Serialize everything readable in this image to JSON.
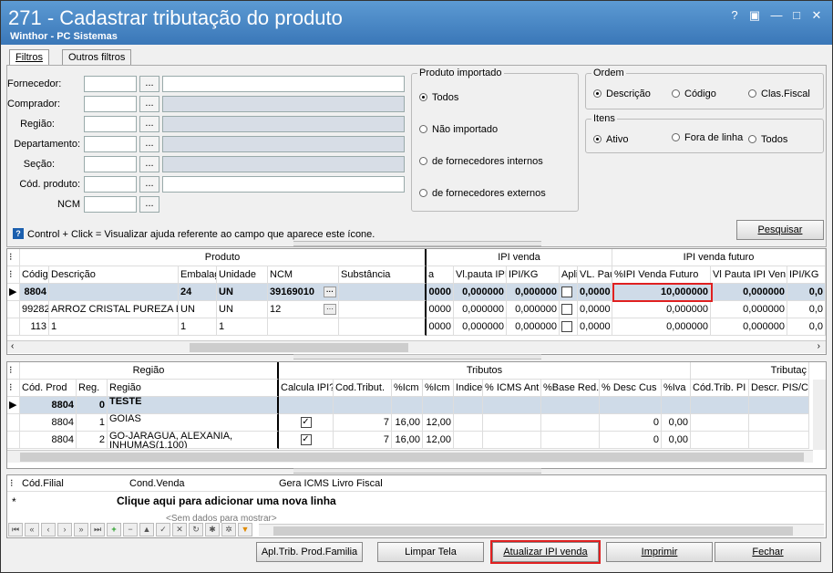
{
  "window": {
    "title": "271 - Cadastrar tributação do produto",
    "subtitle": "Winthor - PC Sistemas",
    "controls": {
      "help": "?",
      "restore": "▣",
      "minimize": "—",
      "maximize": "□",
      "close": "✕"
    }
  },
  "tabs": [
    "Filtros",
    "Outros filtros"
  ],
  "filters": {
    "fornecedor": "Fornecedor:",
    "comprador": "Comprador:",
    "regiao": "Região:",
    "departamento": "Departamento:",
    "secao": "Seção:",
    "cod_produto": "Cód. produto:",
    "ncm": "NCM",
    "dots": "..."
  },
  "produto_importado": {
    "title": "Produto importado",
    "options": [
      "Todos",
      "Não importado",
      "de fornecedores internos",
      "de fornecedores externos"
    ],
    "selected": 0
  },
  "ordem": {
    "title": "Ordem",
    "options": [
      "Descrição",
      "Código",
      "Clas.Fiscal"
    ],
    "selected": 0
  },
  "itens": {
    "title": "Itens",
    "options": [
      "Ativo",
      "Fora de linha",
      "Todos"
    ],
    "selected": 0
  },
  "pesquisar": "Pesquisar",
  "hint": "Control + Click = Visualizar ajuda referente ao campo que aparece este ícone.",
  "grid1": {
    "bands": [
      "Produto",
      "IPI venda",
      "IPI venda futuro"
    ],
    "headers": [
      "Códig",
      "Descrição",
      "Embalag",
      "Unidade",
      "NCM",
      "Substância",
      "a",
      "Vl.pauta IPI",
      "IPI/KG",
      "Apli",
      "VL. Pau",
      "%IPI Venda Futuro",
      "Vl Pauta IPI Ven",
      "IPI/KG"
    ],
    "rows": [
      [
        "8804",
        "",
        "24",
        "UN",
        "39169010",
        "",
        "0000",
        "0,000000",
        "0,000000",
        "",
        "0,0000",
        "10,000000",
        "0,000000",
        "0,0"
      ],
      [
        "99282",
        "ARROZ  CRISTAL PUREZA E",
        "UN",
        "UN",
        "12",
        "",
        "0000",
        "0,000000",
        "0,000000",
        "",
        "0,0000",
        "0,000000",
        "0,000000",
        "0,0"
      ],
      [
        "113",
        "1",
        "1",
        "1",
        "",
        "",
        "0000",
        "0,000000",
        "0,000000",
        "",
        "0,0000",
        "0,000000",
        "0,000000",
        "0,0"
      ]
    ]
  },
  "grid2": {
    "bands": [
      "Região",
      "Tributos",
      "Tributaç"
    ],
    "headers": [
      "Cód. Prod",
      "Reg.",
      "Região",
      "Calcula IPI?",
      "Cod.Tribut.",
      "%Icm",
      "%Icm",
      "Indice",
      "% ICMS Ant",
      "%Base Red.",
      "% Desc Cus",
      "%Iva",
      "Cód.Trib. PI",
      "Descr. PIS/CO"
    ],
    "rows": [
      [
        "8804",
        "0",
        "TESTE",
        "",
        "",
        "",
        "",
        "",
        "",
        "",
        "",
        "",
        "",
        ""
      ],
      [
        "8804",
        "1",
        "GOIAS",
        "✓",
        "7",
        "16,00",
        "12,00",
        "",
        "",
        "",
        "0",
        "0,00",
        "",
        ""
      ],
      [
        "8804",
        "2",
        "GO-JARAGUA, ALEXANIA, INHUMAS(1.100)",
        "✓",
        "7",
        "16,00",
        "12,00",
        "",
        "",
        "",
        "0",
        "0,00",
        "",
        ""
      ]
    ]
  },
  "grid3": {
    "headers": [
      "Cód.Filial",
      "Cond.Venda",
      "Gera ICMS Livro Fiscal"
    ],
    "add_row": "Clique aqui para adicionar uma nova linha",
    "empty": "<Sem dados para mostrar>"
  },
  "buttons": {
    "apl": "Apl.Trib. Prod.Familia",
    "limpar": "Limpar Tela",
    "atualizar": "Atualizar IPI venda",
    "imprimir": "Imprimir",
    "fechar": "Fechar"
  },
  "colors": {
    "title_bg": "#3a77b8",
    "highlight": "#e02020",
    "selected_row": "#cfdbe8"
  }
}
